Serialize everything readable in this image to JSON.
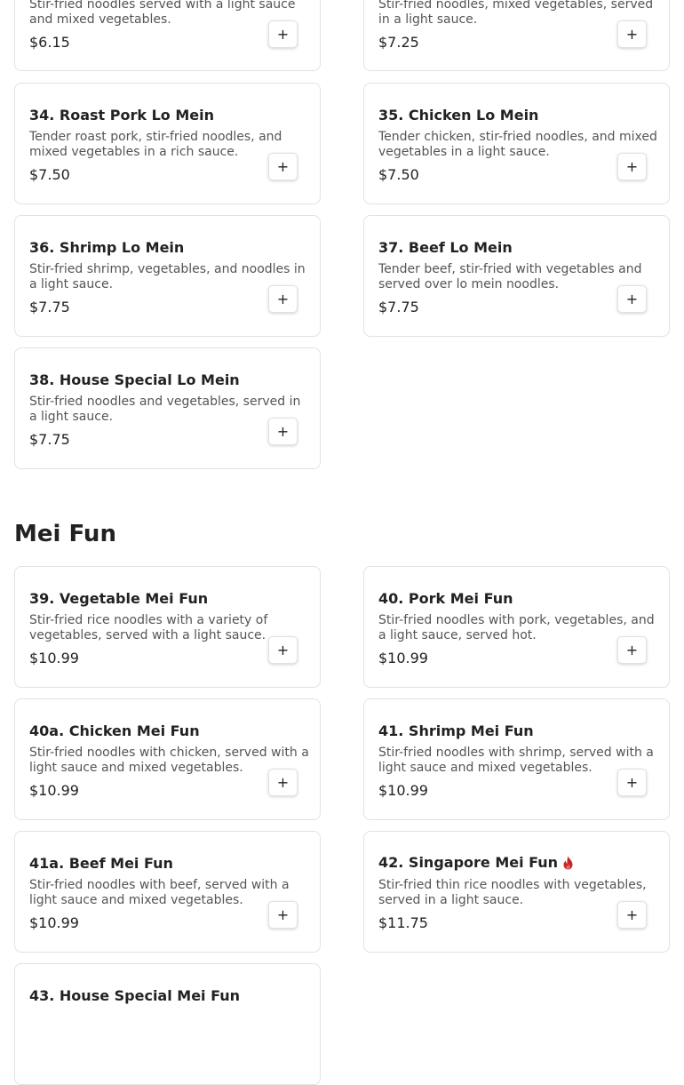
{
  "colors": {
    "accent_flame": "#c62828",
    "card_border": "#e2e2e2",
    "text_muted": "#555555"
  },
  "lo_mein": {
    "items": [
      {
        "title": "",
        "description": "Stir-fried noodles served with a light sauce and mixed vegetables.",
        "price": "$6.15",
        "add_label": "+"
      },
      {
        "title": "",
        "description": "Stir-fried noodles, mixed vegetables, served in a light sauce.",
        "price": "$7.25",
        "add_label": "+"
      },
      {
        "title": "34. Roast Pork Lo Mein",
        "description": "Tender roast pork, stir-fried noodles, and mixed vegetables in a rich sauce.",
        "price": "$7.50",
        "add_label": "+"
      },
      {
        "title": "35. Chicken Lo Mein",
        "description": "Tender chicken, stir-fried noodles, and mixed vegetables in a light sauce.",
        "price": "$7.50",
        "add_label": "+"
      },
      {
        "title": "36. Shrimp Lo Mein",
        "description": "Stir-fried shrimp, vegetables, and noodles in a light sauce.",
        "price": "$7.75",
        "add_label": "+"
      },
      {
        "title": "37. Beef Lo Mein",
        "description": "Tender beef, stir-fried with vegetables and served over lo mein noodles.",
        "price": "$7.75",
        "add_label": "+"
      },
      {
        "title": "38. House Special Lo Mein",
        "description": "Stir-fried noodles and vegetables, served in a light sauce.",
        "price": "$7.75",
        "add_label": "+"
      }
    ]
  },
  "mei_fun": {
    "heading": "Mei Fun",
    "items": [
      {
        "title": "39. Vegetable Mei Fun",
        "description": "Stir-fried rice noodles with a variety of vegetables, served with a light sauce.",
        "price": "$10.99",
        "add_label": "+"
      },
      {
        "title": "40. Pork Mei Fun",
        "description": "Stir-fried noodles with pork, vegetables, and a light sauce, served hot.",
        "price": "$10.99",
        "add_label": "+"
      },
      {
        "title": "40a. Chicken Mei Fun",
        "description": "Stir-fried noodles with chicken, served with a light sauce and mixed vegetables.",
        "price": "$10.99",
        "add_label": "+"
      },
      {
        "title": "41. Shrimp Mei Fun",
        "description": "Stir-fried noodles with shrimp, served with a light sauce and mixed vegetables.",
        "price": "$10.99",
        "add_label": "+"
      },
      {
        "title": "41a. Beef Mei Fun",
        "description": "Stir-fried noodles with beef, served with a light sauce and mixed vegetables.",
        "price": "$10.99",
        "add_label": "+"
      },
      {
        "title": "42. Singapore Mei Fun",
        "spicy_icon": "flame-icon",
        "description": "Stir-fried thin rice noodles with vegetables, served in a light sauce.",
        "price": "$11.75",
        "add_label": "+"
      },
      {
        "title": "43. House Special Mei Fun"
      }
    ]
  }
}
